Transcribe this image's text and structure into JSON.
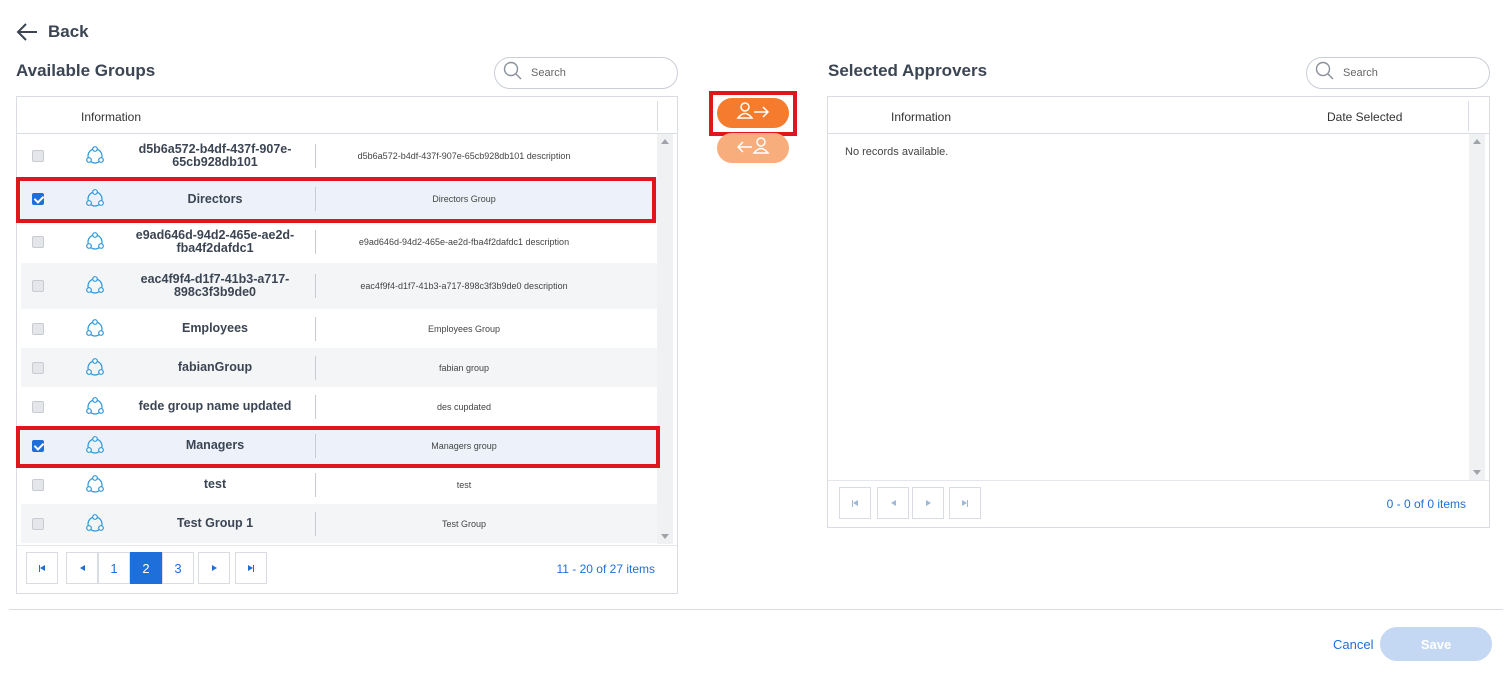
{
  "back_label": "Back",
  "available": {
    "title": "Available Groups",
    "search_placeholder": "Search",
    "header": "Information",
    "rows": [
      {
        "name": "d5b6a572-b4df-437f-907e-65cb928db101",
        "description": "d5b6a572-b4df-437f-907e-65cb928db101 description",
        "checked": false
      },
      {
        "name": "Directors",
        "description": "Directors Group",
        "checked": true
      },
      {
        "name": "e9ad646d-94d2-465e-ae2d-fba4f2dafdc1",
        "description": "e9ad646d-94d2-465e-ae2d-fba4f2dafdc1 description",
        "checked": false
      },
      {
        "name": "eac4f9f4-d1f7-41b3-a717-898c3f3b9de0",
        "description": "eac4f9f4-d1f7-41b3-a717-898c3f3b9de0 description",
        "checked": false
      },
      {
        "name": "Employees",
        "description": "Employees Group",
        "checked": false
      },
      {
        "name": "fabianGroup",
        "description": "fabian group",
        "checked": false
      },
      {
        "name": "fede group name updated",
        "description": "des cupdated",
        "checked": false
      },
      {
        "name": "Managers",
        "description": "Managers group",
        "checked": true
      },
      {
        "name": "test",
        "description": "test",
        "checked": false
      },
      {
        "name": "Test Group 1",
        "description": "Test Group",
        "checked": false
      }
    ],
    "pages": [
      "1",
      "2",
      "3"
    ],
    "current_page": "2",
    "pager_info": "11 - 20 of 27 items"
  },
  "selected": {
    "title": "Selected Approvers",
    "search_placeholder": "Search",
    "header_info": "Information",
    "header_date": "Date Selected",
    "empty_text": "No records available.",
    "pager_info": "0 - 0 of 0 items"
  },
  "footer": {
    "cancel_label": "Cancel",
    "save_label": "Save"
  },
  "colors": {
    "accent": "#1e6fd9",
    "transfer_active": "#f57c2f",
    "transfer_inactive": "#f8ad7d",
    "highlight": "#e0161f"
  }
}
